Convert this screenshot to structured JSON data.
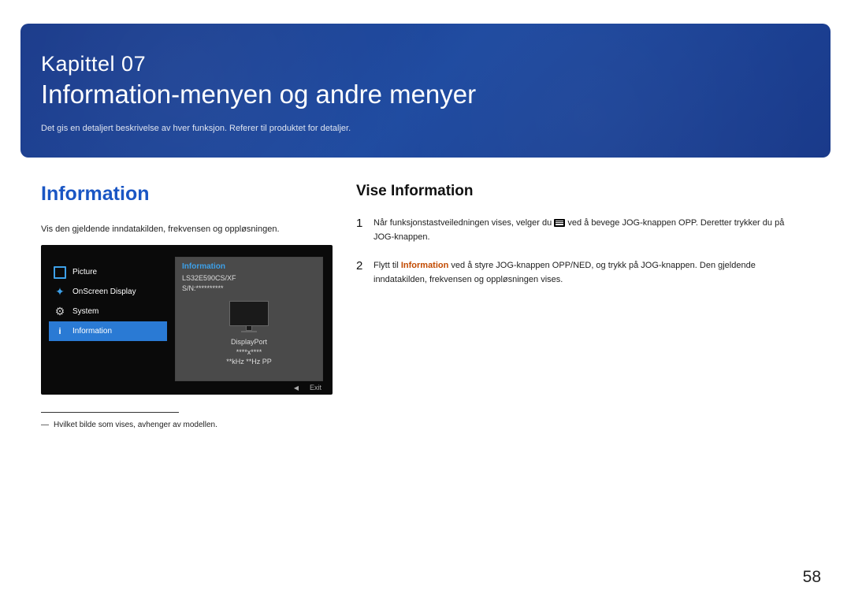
{
  "banner": {
    "chapter_label": "Kapittel  07",
    "title": "Information-menyen og andre menyer",
    "subtitle": "Det gis en detaljert beskrivelse av hver funksjon. Referer til produktet for detaljer."
  },
  "left": {
    "heading": "Information",
    "intro": "Vis den gjeldende inndatakilden, frekvensen og oppløsningen.",
    "footnote_mark": "―",
    "footnote": "Hvilket bilde som vises, avhenger av modellen."
  },
  "osd": {
    "sidebar": {
      "picture": "Picture",
      "onscreen": "OnScreen Display",
      "system": "System",
      "information": "Information"
    },
    "panel": {
      "title": "Information",
      "model": "LS32E590CS/XF",
      "serial": "S/N:**********",
      "port": "DisplayPort",
      "resolution": "****x****",
      "freq": "**kHz **Hz PP"
    },
    "footer": {
      "arrow": "◀",
      "exit": "Exit"
    }
  },
  "right": {
    "heading": "Vise Information",
    "steps": {
      "s1_num": "1",
      "s1_pre": "Når funksjonstastveiledningen vises, velger du ",
      "s1_post": " ved å bevege JOG-knappen OPP. Deretter trykker du på JOG-knappen.",
      "s2_num": "2",
      "s2_pre": "Flytt til ",
      "s2_highlight": "Information",
      "s2_post": " ved å styre JOG-knappen OPP/NED, og trykk på JOG-knappen. Den gjeldende inndatakilden, frekvensen og oppløsningen vises."
    }
  },
  "page_number": "58"
}
